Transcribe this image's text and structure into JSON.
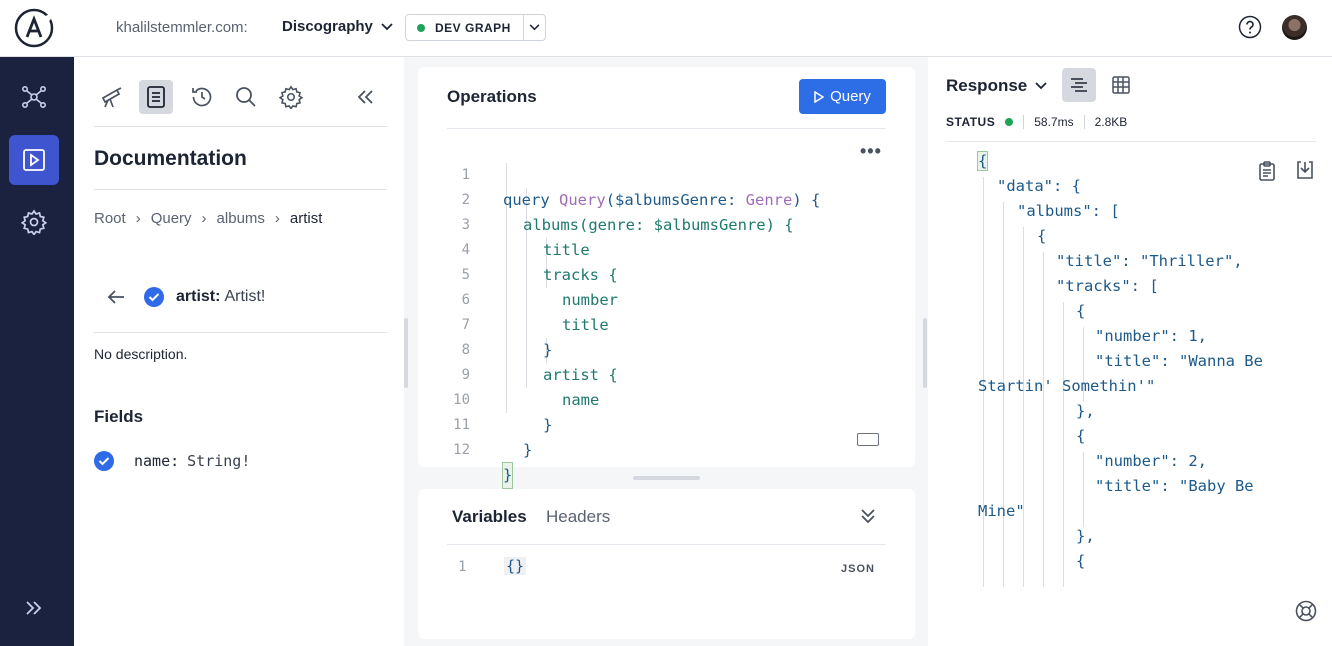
{
  "topbar": {
    "site": "khalilstemmler.com:",
    "graph": "Discography",
    "variant": "DEV GRAPH",
    "variant_status_color": "#1fa35b"
  },
  "leftnav": {
    "icons": [
      "graph-icon",
      "explorer-play-icon",
      "settings-icon",
      "expand-icon"
    ],
    "active": "explorer-play-icon"
  },
  "docs": {
    "tools": [
      "telescope-icon",
      "documentation-icon",
      "history-icon",
      "search-icon",
      "settings-icon",
      "collapse-left-icon"
    ],
    "title": "Documentation",
    "breadcrumb": [
      "Root",
      "Query",
      "albums",
      "artist"
    ],
    "field_name": "artist:",
    "field_type": "Artist!",
    "description": "No description.",
    "fields_heading": "Fields",
    "fields": [
      {
        "name": "name:",
        "type": "String!"
      }
    ]
  },
  "operations": {
    "title": "Operations",
    "run_label": "Query",
    "lines": [
      {
        "n": "1"
      },
      {
        "n": "2"
      },
      {
        "n": "3"
      },
      {
        "n": "4"
      },
      {
        "n": "5"
      },
      {
        "n": "6"
      },
      {
        "n": "7"
      },
      {
        "n": "8"
      },
      {
        "n": "9"
      },
      {
        "n": "10"
      },
      {
        "n": "11"
      },
      {
        "n": "12"
      }
    ],
    "code": {
      "l1_kw": "query",
      "l1_name": "Query",
      "l1_args": "($albumsGenre: ",
      "l1_type": "Genre",
      "l1_end": ") {",
      "l2": "albums(genre: $albumsGenre) {",
      "l3": "title",
      "l4": "tracks {",
      "l5": "number",
      "l6": "title",
      "l7": "}",
      "l8": "artist {",
      "l9": "name",
      "l10": "}",
      "l11": "}",
      "l12": "}"
    },
    "more": "•••"
  },
  "variables": {
    "tab_variables": "Variables",
    "tab_headers": "Headers",
    "line": "1",
    "value": "{}",
    "format": "JSON"
  },
  "response": {
    "title": "Response",
    "status_label": "STATUS",
    "status_color": "#1fa35b",
    "time": "58.7ms",
    "size": "2.8KB",
    "json_lines": [
      "{",
      "\"data\": {",
      "\"albums\": [",
      "{",
      "\"title\": \"Thriller\",",
      "\"tracks\": [",
      "{",
      "\"number\": 1,",
      "\"title\": \"Wanna Be",
      "Startin' Somethin'\"",
      "},",
      "{",
      "\"number\": 2,",
      "\"title\": \"Baby Be",
      "Mine\"",
      "},",
      "{"
    ]
  }
}
